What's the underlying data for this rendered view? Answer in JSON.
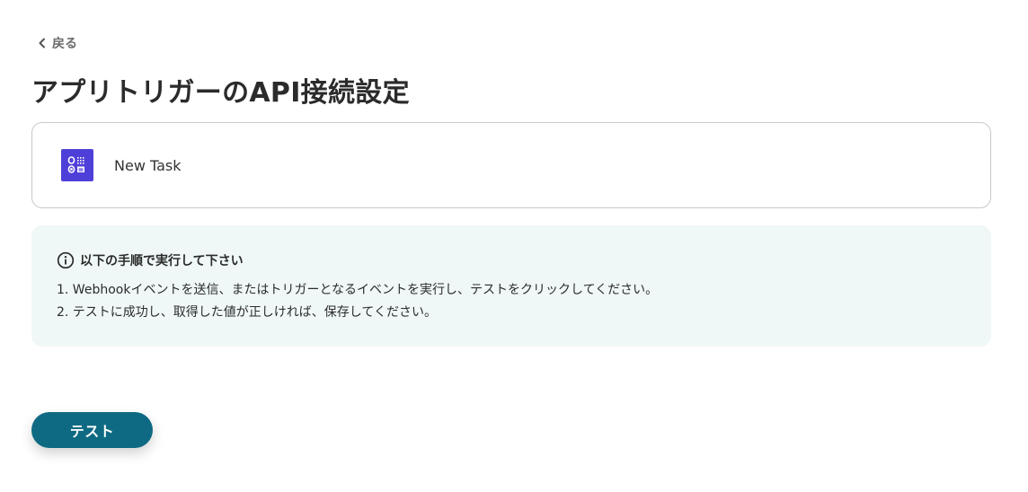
{
  "nav": {
    "back_label": "戻る",
    "back_icon": "chevron-left-icon"
  },
  "page": {
    "title": "アプリトリガーのAPI接続設定"
  },
  "trigger": {
    "app_icon": "app-logo-icon",
    "name": "New Task",
    "icon_color": "#4f3fd9"
  },
  "instructions": {
    "icon": "info-icon",
    "heading": "以下の手順で実行して下さい",
    "steps": [
      "1. Webhookイベントを送信、またはトリガーとなるイベントを実行し、テストをクリックしてください。",
      "2. テストに成功し、取得した値が正しければ、保存してください。"
    ],
    "background_color": "#eff8f7"
  },
  "actions": {
    "test_label": "テスト",
    "test_color": "#0e6a82"
  }
}
